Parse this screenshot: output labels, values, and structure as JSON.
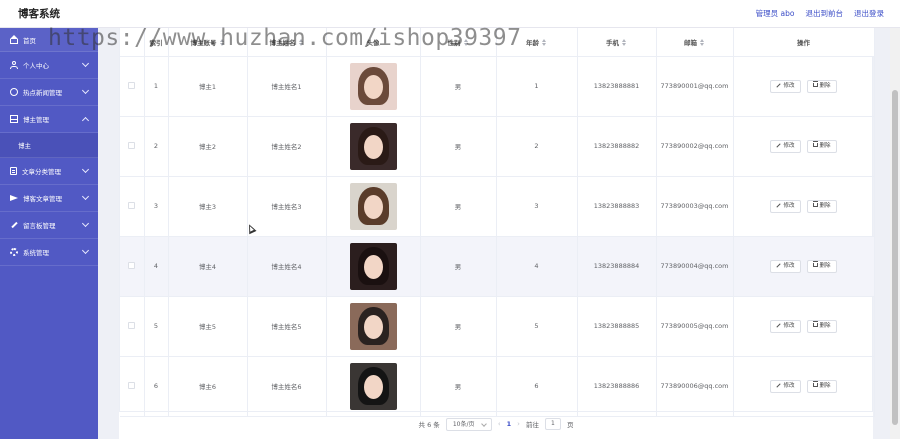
{
  "header": {
    "title": "博客系统",
    "user_label": "管理员 abo",
    "frontend_link": "退出到前台",
    "logout_link": "退出登录"
  },
  "sidebar": {
    "items": [
      {
        "label": "首页",
        "icon": "home-icon"
      },
      {
        "label": "个人中心",
        "icon": "user-icon"
      },
      {
        "label": "热点新闻管理",
        "icon": "news-icon"
      },
      {
        "label": "博主管理",
        "icon": "blogger-icon",
        "expanded": true
      },
      {
        "label": "博主",
        "sub": true
      },
      {
        "label": "文章分类管理",
        "icon": "category-icon"
      },
      {
        "label": "博客文章管理",
        "icon": "article-icon"
      },
      {
        "label": "留言板管理",
        "icon": "message-icon"
      },
      {
        "label": "系统管理",
        "icon": "settings-icon"
      }
    ]
  },
  "table": {
    "columns": [
      "索引",
      "博主账号",
      "博主姓名",
      "头像",
      "性别",
      "年龄",
      "手机",
      "邮箱",
      "操作"
    ],
    "edit_label": "修改",
    "delete_label": "删除",
    "rows": [
      {
        "index": "1",
        "account": "博主1",
        "name": "博主姓名1",
        "gender": "男",
        "age": "1",
        "phone": "13823888881",
        "email": "773890001@qq.com"
      },
      {
        "index": "2",
        "account": "博主2",
        "name": "博主姓名2",
        "gender": "男",
        "age": "2",
        "phone": "13823888882",
        "email": "773890002@qq.com"
      },
      {
        "index": "3",
        "account": "博主3",
        "name": "博主姓名3",
        "gender": "男",
        "age": "3",
        "phone": "13823888883",
        "email": "773890003@qq.com"
      },
      {
        "index": "4",
        "account": "博主4",
        "name": "博主姓名4",
        "gender": "男",
        "age": "4",
        "phone": "13823888884",
        "email": "773890004@qq.com"
      },
      {
        "index": "5",
        "account": "博主5",
        "name": "博主姓名5",
        "gender": "男",
        "age": "5",
        "phone": "13823888885",
        "email": "773890005@qq.com"
      },
      {
        "index": "6",
        "account": "博主6",
        "name": "博主姓名6",
        "gender": "男",
        "age": "6",
        "phone": "13823888886",
        "email": "773890006@qq.com"
      }
    ]
  },
  "pagination": {
    "total": "共 6 条",
    "page_size": "10条/页",
    "current_page": "1",
    "goto_label": "前往",
    "goto_value": "1",
    "page_unit": "页"
  },
  "watermark": "https://www.huzhan.com/ishop39397",
  "colors": {
    "sidebar": "#5159c4",
    "accent": "#3a4cc7",
    "highlight_row": "#f3f4fa"
  }
}
